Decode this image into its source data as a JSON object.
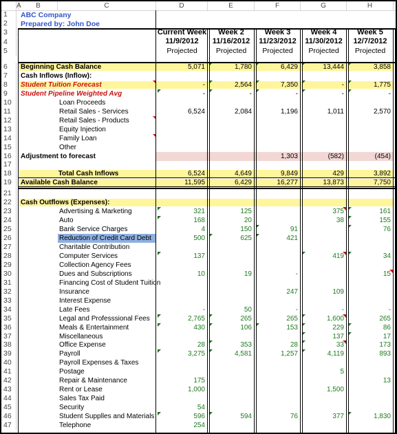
{
  "column_headers": [
    "A",
    "B",
    "C",
    "D",
    "E",
    "F",
    "G",
    "H"
  ],
  "header": {
    "company": "ABC Company",
    "prepared_by": "Prepared by: John Doe",
    "weeks": [
      {
        "name": "Current Week",
        "date": "11/9/2012",
        "status": "Projected"
      },
      {
        "name": "Week 2",
        "date": "11/16/2012",
        "status": "Projected"
      },
      {
        "name": "Week 3",
        "date": "11/23/2012",
        "status": "Projected"
      },
      {
        "name": "Week 4",
        "date": "11/30/2012",
        "status": "Projected"
      },
      {
        "name": "Week 5",
        "date": "12/7/2012",
        "status": "Projected"
      }
    ]
  },
  "rows": [
    {
      "n": "6",
      "label": "Beginning Cash Balance",
      "style": "bold",
      "fill": "yellow",
      "values": [
        "5,071",
        "1,780",
        "6,429",
        "13,444",
        "3,858"
      ]
    },
    {
      "n": "7",
      "label": "Cash Inflows (Inflow):",
      "style": "bold",
      "values": [
        "",
        "",
        "",
        "",
        ""
      ]
    },
    {
      "n": "8",
      "label": "Student Tuition Forecast",
      "style": "red-ital",
      "fill": "yellow",
      "values": [
        "-",
        "2,564",
        "7,350",
        "-",
        "1,775"
      ]
    },
    {
      "n": "9",
      "label": "Student Pipeline Weighted Avg",
      "style": "red-ital",
      "values": [
        "-",
        "-",
        "-",
        "-",
        "-"
      ]
    },
    {
      "n": "10",
      "label": "Loan Proceeds",
      "indent": true,
      "values": [
        "",
        "",
        "",
        "",
        ""
      ]
    },
    {
      "n": "11",
      "label": "Retail Sales - Services",
      "indent": true,
      "values": [
        "6,524",
        "2,084",
        "1,196",
        "1,011",
        "2,570"
      ]
    },
    {
      "n": "12",
      "label": "Retail Sales - Products",
      "indent": true,
      "values": [
        "",
        "",
        "",
        "",
        ""
      ]
    },
    {
      "n": "13",
      "label": "Equity Injection",
      "indent": true,
      "values": [
        "",
        "",
        "",
        "",
        ""
      ]
    },
    {
      "n": "14",
      "label": "Family Loan",
      "indent": true,
      "values": [
        "",
        "",
        "",
        "",
        ""
      ]
    },
    {
      "n": "15",
      "label": "Other",
      "indent": true,
      "values": [
        "",
        "",
        "",
        "",
        ""
      ]
    },
    {
      "n": "16",
      "label": "Adjustment to forecast",
      "style": "bold",
      "fill": "pink",
      "values": [
        "",
        "",
        "1,303",
        "(582)",
        "(454)"
      ]
    },
    {
      "n": "17",
      "label": "",
      "values": [
        "",
        "",
        "",
        "",
        ""
      ]
    },
    {
      "n": "18",
      "label": "Total Cash Inflows",
      "style": "bold",
      "center": true,
      "fill": "yellow",
      "values": [
        "6,524",
        "4,649",
        "9,849",
        "429",
        "3,892"
      ]
    },
    {
      "n": "19",
      "label": "Available Cash Balance",
      "style": "bold",
      "fill": "yellow",
      "values": [
        "11,595",
        "6,429",
        "16,277",
        "13,873",
        "7,750"
      ]
    },
    {
      "n": "21",
      "label": "",
      "values": [
        "",
        "",
        "",
        "",
        ""
      ]
    },
    {
      "n": "22",
      "label": "Cash Outflows (Expenses):",
      "style": "bold",
      "fill": "yellow",
      "values": [
        "",
        "",
        "",
        "",
        ""
      ]
    },
    {
      "n": "23",
      "label": "Advertising & Marketing",
      "indent": true,
      "green": true,
      "values": [
        "321",
        "125",
        "",
        "375",
        "161"
      ]
    },
    {
      "n": "24",
      "label": "Auto",
      "indent": true,
      "green": true,
      "values": [
        "168",
        "20",
        "",
        "38",
        "155"
      ]
    },
    {
      "n": "25",
      "label": "Bank Service Charges",
      "indent": true,
      "green": true,
      "values": [
        "4",
        "150",
        "91",
        "",
        "76"
      ]
    },
    {
      "n": "26",
      "label": "Reduction of Credit Card Debt",
      "indent": true,
      "green": true,
      "selected": true,
      "values": [
        "500",
        "625",
        "421",
        "",
        ""
      ]
    },
    {
      "n": "27",
      "label": "Charitable Contribution",
      "indent": true,
      "green": true,
      "values": [
        "",
        "",
        "",
        "",
        ""
      ]
    },
    {
      "n": "28",
      "label": "Computer Services",
      "indent": true,
      "green": true,
      "values": [
        "137",
        "",
        "",
        "419",
        "34"
      ]
    },
    {
      "n": "29",
      "label": "Collection Agency Fees",
      "indent": true,
      "green": true,
      "values": [
        "",
        "",
        "",
        "",
        ""
      ]
    },
    {
      "n": "30",
      "label": "Dues and Subscriptions",
      "indent": true,
      "green": true,
      "values": [
        "10",
        "19",
        "-",
        "",
        "15"
      ]
    },
    {
      "n": "31",
      "label": "Financing Cost of Student Tuition",
      "indent": true,
      "green": true,
      "values": [
        "",
        "",
        "",
        "",
        ""
      ]
    },
    {
      "n": "32",
      "label": "Insurance",
      "indent": true,
      "green": true,
      "values": [
        "",
        "",
        "247",
        "109",
        ""
      ]
    },
    {
      "n": "33",
      "label": "Interest Expense",
      "indent": true,
      "green": true,
      "values": [
        "",
        "",
        "",
        "",
        ""
      ]
    },
    {
      "n": "34",
      "label": "Late Fees",
      "indent": true,
      "green": true,
      "values": [
        "-",
        "50",
        "-",
        "-",
        "-"
      ]
    },
    {
      "n": "35",
      "label": "Legal and Professsional Fees",
      "indent": true,
      "green": true,
      "values": [
        "2,765",
        "265",
        "265",
        "1,600",
        "265"
      ]
    },
    {
      "n": "36",
      "label": "Meals & Entertainment",
      "indent": true,
      "green": true,
      "values": [
        "430",
        "106",
        "153",
        "229",
        "86"
      ]
    },
    {
      "n": "37",
      "label": "Miscellaneous",
      "indent": true,
      "green": true,
      "values": [
        "",
        "",
        "",
        "137",
        "17"
      ]
    },
    {
      "n": "38",
      "label": "Office Expense",
      "indent": true,
      "green": true,
      "values": [
        "28",
        "353",
        "28",
        "33",
        "173"
      ]
    },
    {
      "n": "39",
      "label": "Payroll",
      "indent": true,
      "green": true,
      "values": [
        "3,275",
        "4,581",
        "1,257",
        "4,119",
        "893"
      ]
    },
    {
      "n": "40",
      "label": "Payroll Expenses & Taxes",
      "indent": true,
      "green": true,
      "values": [
        "",
        "",
        "",
        "",
        ""
      ]
    },
    {
      "n": "41",
      "label": "Postage",
      "indent": true,
      "green": true,
      "values": [
        "",
        "",
        "",
        "5",
        ""
      ]
    },
    {
      "n": "42",
      "label": "Repair & Maintenance",
      "indent": true,
      "green": true,
      "values": [
        "175",
        "",
        "",
        "",
        "13"
      ]
    },
    {
      "n": "43",
      "label": "Rent or Lease",
      "indent": true,
      "green": true,
      "values": [
        "1,000",
        "",
        "",
        "1,500",
        ""
      ]
    },
    {
      "n": "44",
      "label": "Sales Tax Paid",
      "indent": true,
      "green": true,
      "values": [
        "",
        "",
        "",
        "",
        ""
      ]
    },
    {
      "n": "45",
      "label": "Security",
      "indent": true,
      "green": true,
      "values": [
        "54",
        "",
        "",
        "",
        ""
      ]
    },
    {
      "n": "46",
      "label": "Student Supplles and Materials",
      "indent": true,
      "green": true,
      "values": [
        "596",
        "594",
        "76",
        "377",
        "1,830"
      ]
    },
    {
      "n": "47",
      "label": "Telephone",
      "indent": true,
      "green": true,
      "values": [
        "254",
        "",
        "",
        "",
        ""
      ]
    }
  ]
}
